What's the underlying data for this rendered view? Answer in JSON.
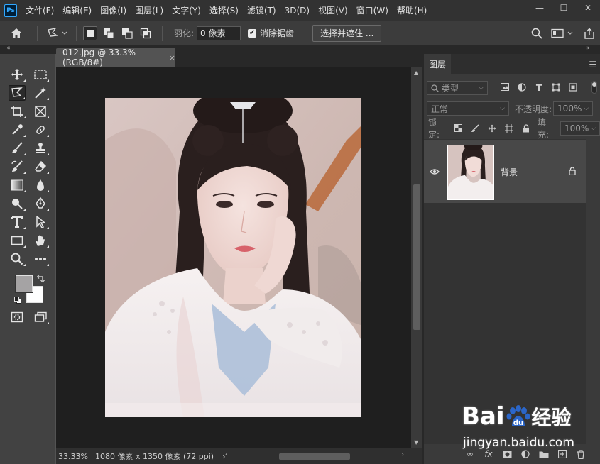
{
  "app": {
    "logo": "Ps"
  },
  "menu": [
    "文件(F)",
    "编辑(E)",
    "图像(I)",
    "图层(L)",
    "文字(Y)",
    "选择(S)",
    "滤镜(T)",
    "3D(D)",
    "视图(V)",
    "窗口(W)",
    "帮助(H)"
  ],
  "window_controls": {
    "minimize": "—",
    "maximize": "☐",
    "close": "✕"
  },
  "options": {
    "feather_label": "羽化:",
    "feather_value": "0 像素",
    "antialias_label": "消除锯齿",
    "antialias_checked": true,
    "select_mask_button": "选择并遮住 ..."
  },
  "document": {
    "tab_title": "012.jpg @ 33.3%(RGB/8#)",
    "tab_close": "×",
    "zoom": "33.33%",
    "info": "1080 像素 x 1350 像素 (72 ppi)",
    "info_arrow": "›"
  },
  "layers_panel": {
    "tab": "图层",
    "filter_type": "类型",
    "blend_mode": "正常",
    "opacity_label": "不透明度:",
    "opacity_value": "100%",
    "lock_label": "锁定:",
    "fill_label": "填充:",
    "fill_value": "100%",
    "layers": [
      {
        "name": "背景",
        "visible": true,
        "locked": true
      }
    ]
  },
  "watermark": {
    "brand_left": "Bai",
    "brand_right": "经验",
    "url": "jingyan.baidu.com"
  },
  "colors": {
    "foreground": "#a5a3a4",
    "background": "#ffffff",
    "accent": "#31a8ff",
    "watermark_blue": "#2b66c9"
  }
}
